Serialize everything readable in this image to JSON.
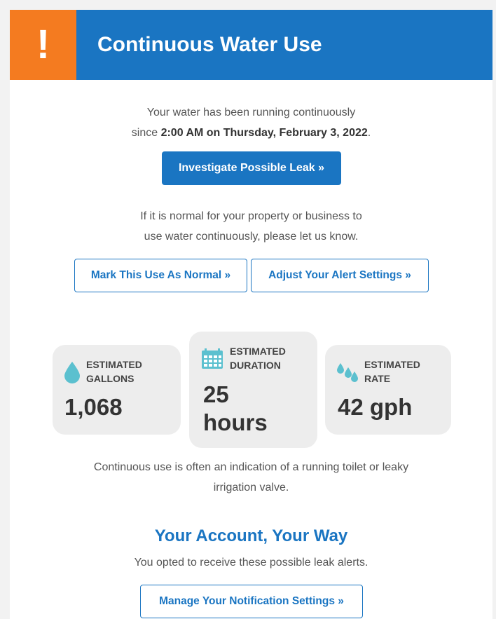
{
  "header": {
    "alert_symbol": "!",
    "title": "Continuous Water Use",
    "color": "#1a75c2",
    "alert_color": "#f47b20"
  },
  "intro": {
    "line1": "Your water has been running continuously",
    "line2_prefix": "since ",
    "since_time": "2:00 AM on Thursday, February 3, 2022",
    "line2_suffix": "."
  },
  "buttons": {
    "investigate": "Investigate Possible Leak »",
    "mark_normal": "Mark This Use As Normal »",
    "adjust_alerts": "Adjust Your Alert Settings »",
    "manage_notifications": "Manage Your Notification Settings »"
  },
  "normal_note": {
    "line1": "If it is normal for your property or business to",
    "line2": "use water continuously, please let us know."
  },
  "stats": {
    "gallons": {
      "label_line1": "ESTIMATED",
      "label_line2": "GALLONS",
      "value": "1,068",
      "icon": "water-drop-icon"
    },
    "duration": {
      "label_line1": "ESTIMATED",
      "label_line2": "DURATION",
      "value_line1": "25",
      "value_line2": "hours",
      "icon": "calendar-icon"
    },
    "rate": {
      "label_line1": "ESTIMATED",
      "label_line2": "RATE",
      "value": "42 gph",
      "icon": "water-drops-icon"
    }
  },
  "explanation": {
    "line1": "Continuous use is often an indication of a running toilet or leaky",
    "line2": "irrigation valve."
  },
  "account": {
    "title": "Your Account, Your Way",
    "subtitle": "You opted to receive these possible leak alerts."
  }
}
